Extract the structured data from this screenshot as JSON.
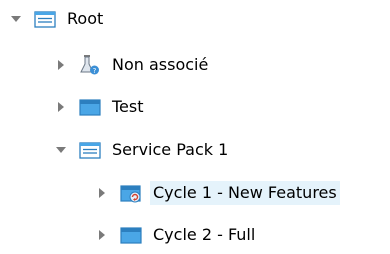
{
  "tree": {
    "root": {
      "label": "Root",
      "expanded": true
    },
    "items": [
      {
        "label": "Non associé",
        "icon": "unassigned-icon",
        "expanded": false
      },
      {
        "label": "Test",
        "icon": "folder-icon",
        "expanded": false
      },
      {
        "label": "Service Pack 1",
        "icon": "folder-open-icon",
        "expanded": true
      },
      {
        "label": "Cycle 1 - New Features",
        "icon": "cycle-folder-icon",
        "expanded": false,
        "selected": true
      },
      {
        "label": "Cycle 2 - Full",
        "icon": "folder-icon",
        "expanded": false
      }
    ]
  },
  "colors": {
    "folder": "#4aa6e6",
    "folder_dark": "#2c7fbf",
    "arrow": "#7a7a7a",
    "selection": "#e5f3fb"
  }
}
